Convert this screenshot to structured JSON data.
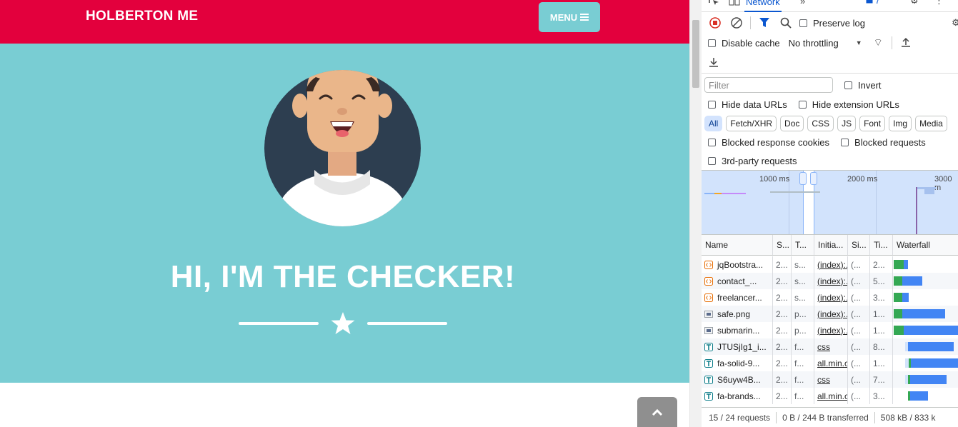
{
  "site": {
    "brand": "HOLBERTON ME",
    "menu_label": "MENU",
    "hero_title": "HI, I'M THE CHECKER!",
    "colors": {
      "navbar": "#e3003d",
      "hero": "#79cdd3",
      "menu_button": "#79cdd3"
    }
  },
  "devtools": {
    "active_tab": "Network",
    "issues_count": "7",
    "preserve_log": "Preserve log",
    "disable_cache": "Disable cache",
    "throttling": "No throttling",
    "filter_placeholder": "Filter",
    "invert": "Invert",
    "hide_data_urls": "Hide data URLs",
    "hide_extension_urls": "Hide extension URLs",
    "type_filters": [
      "All",
      "Fetch/XHR",
      "Doc",
      "CSS",
      "JS",
      "Font",
      "Img",
      "Media"
    ],
    "blocked_response_cookies": "Blocked response cookies",
    "blocked_requests": "Blocked requests",
    "third_party_requests": "3rd-party requests",
    "timeline_ticks": [
      "1000 ms",
      "2000 ms",
      "3000 m"
    ],
    "columns": [
      "Name",
      "S...",
      "T...",
      "Initia...",
      "Si...",
      "Ti...",
      "Waterfall"
    ],
    "requests": [
      {
        "icon": "script-icon",
        "name": "jqBootstra...",
        "status": "2...",
        "type": "s...",
        "initiator": "(index):...",
        "size": "(...",
        "time": "2..."
      },
      {
        "icon": "script-icon",
        "name": "contact_...",
        "status": "2...",
        "type": "s...",
        "initiator": "(index):...",
        "size": "(...",
        "time": "5..."
      },
      {
        "icon": "script-icon",
        "name": "freelancer...",
        "status": "2...",
        "type": "s...",
        "initiator": "(index):...",
        "size": "(...",
        "time": "3..."
      },
      {
        "icon": "image-icon",
        "name": "safe.png",
        "status": "2...",
        "type": "p...",
        "initiator": "(index):...",
        "size": "(...",
        "time": "1..."
      },
      {
        "icon": "image-icon",
        "name": "submarin...",
        "status": "2...",
        "type": "p...",
        "initiator": "(index):...",
        "size": "(...",
        "time": "1..."
      },
      {
        "icon": "font-icon",
        "name": "JTUSjIg1_i...",
        "status": "2...",
        "type": "f...",
        "initiator": "css",
        "size": "(...",
        "time": "8..."
      },
      {
        "icon": "font-icon",
        "name": "fa-solid-9...",
        "status": "2...",
        "type": "f...",
        "initiator": "all.min.c...",
        "size": "(...",
        "time": "1..."
      },
      {
        "icon": "font-icon",
        "name": "S6uyw4B...",
        "status": "2...",
        "type": "f...",
        "initiator": "css",
        "size": "(...",
        "time": "7..."
      },
      {
        "icon": "font-icon",
        "name": "fa-brands...",
        "status": "2...",
        "type": "f...",
        "initiator": "all.min.c...",
        "size": "(...",
        "time": "3..."
      }
    ],
    "status": {
      "requests": "15 / 24 requests",
      "transferred": "0 B / 244 B transferred",
      "resources": "508 kB / 833 k"
    }
  }
}
